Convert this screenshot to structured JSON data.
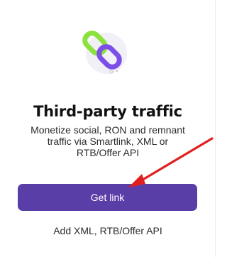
{
  "card": {
    "illustration": "linked-chains-icon",
    "title": "Third-party traffic",
    "description": "Monetize social, RON and remnant traffic via Smartlink, XML or RTB/Offer API",
    "cta_label": "Get link",
    "secondary_label": "Add XML, RTB/Offer API"
  },
  "annotation": {
    "arrow_icon": "red-arrow-icon",
    "color": "#e02020"
  },
  "colors": {
    "accent": "#5a3ea8",
    "chain_green": "#8ce23c",
    "chain_purple": "#7d4ee8"
  }
}
